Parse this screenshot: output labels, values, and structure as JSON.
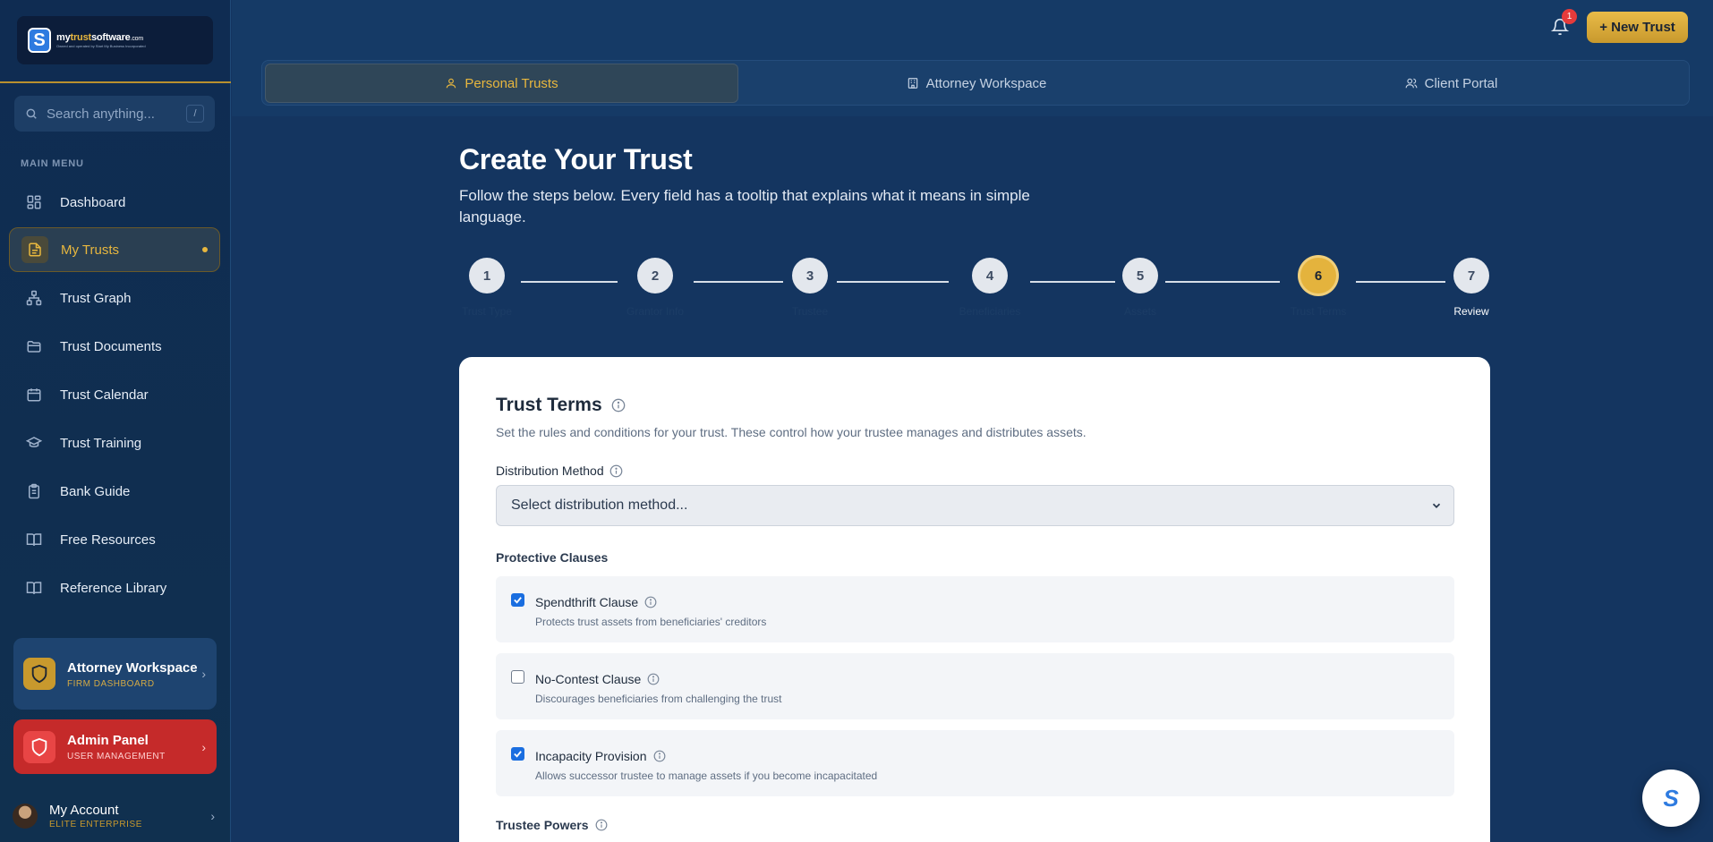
{
  "brand": {
    "logo_letter": "S",
    "name_prefix": "my",
    "name_highlight": "trust",
    "name_suffix": "software",
    "name_tld": ".com",
    "tagline": "Owned and operated by Start My Business Incorporated"
  },
  "search": {
    "placeholder": "Search anything...",
    "shortcut": "/"
  },
  "sidebar": {
    "section_title": "MAIN MENU",
    "items": [
      {
        "label": "Dashboard",
        "icon": "grid-icon"
      },
      {
        "label": "My Trusts",
        "icon": "document-icon",
        "active": true
      },
      {
        "label": "Trust Graph",
        "icon": "graph-icon"
      },
      {
        "label": "Trust Documents",
        "icon": "folder-icon"
      },
      {
        "label": "Trust Calendar",
        "icon": "calendar-icon"
      },
      {
        "label": "Trust Training",
        "icon": "graduation-cap-icon"
      },
      {
        "label": "Bank Guide",
        "icon": "clipboard-icon"
      },
      {
        "label": "Free Resources",
        "icon": "book-icon"
      },
      {
        "label": "Reference Library",
        "icon": "book-icon"
      }
    ],
    "attorney_card": {
      "title": "Attorney Workspace",
      "subtitle": "FIRM DASHBOARD"
    },
    "admin_card": {
      "title": "Admin Panel",
      "subtitle": "USER MANAGEMENT"
    },
    "account": {
      "name": "My Account",
      "plan": "ELITE ENTERPRISE"
    }
  },
  "header": {
    "notification_count": "1",
    "new_trust_label": "+ New Trust",
    "tabs": [
      {
        "label": "Personal Trusts",
        "active": true
      },
      {
        "label": "Attorney Workspace"
      },
      {
        "label": "Client Portal"
      }
    ]
  },
  "main": {
    "title": "Create Your Trust",
    "subtitle": "Follow the steps below. Every field has a tooltip that explains what it means in simple language.",
    "steps": [
      {
        "number": "1",
        "label": "Trust Type"
      },
      {
        "number": "2",
        "label": "Grantor Info"
      },
      {
        "number": "3",
        "label": "Trustee"
      },
      {
        "number": "4",
        "label": "Beneficiaries"
      },
      {
        "number": "5",
        "label": "Assets"
      },
      {
        "number": "6",
        "label": "Trust Terms",
        "active": true
      },
      {
        "number": "7",
        "label": "Review"
      }
    ]
  },
  "form": {
    "heading": "Trust Terms",
    "description": "Set the rules and conditions for your trust. These control how your trustee manages and distributes assets.",
    "distribution_label": "Distribution Method",
    "distribution_placeholder": "Select distribution method...",
    "protective_title": "Protective Clauses",
    "clauses": [
      {
        "title": "Spendthrift Clause",
        "desc": "Protects trust assets from beneficiaries' creditors",
        "checked": true
      },
      {
        "title": "No-Contest Clause",
        "desc": "Discourages beneficiaries from challenging the trust",
        "checked": false
      },
      {
        "title": "Incapacity Provision",
        "desc": "Allows successor trustee to manage assets if you become incapacitated",
        "checked": true
      }
    ],
    "trustee_powers_label": "Trustee Powers"
  },
  "chat": {
    "letter": "S"
  },
  "colors": {
    "accent": "#e8b73e",
    "sidebar_bg": "#0f2c52",
    "page_bg": "#143560",
    "admin": "#c52a2a",
    "checkbox": "#1a6ee0"
  }
}
